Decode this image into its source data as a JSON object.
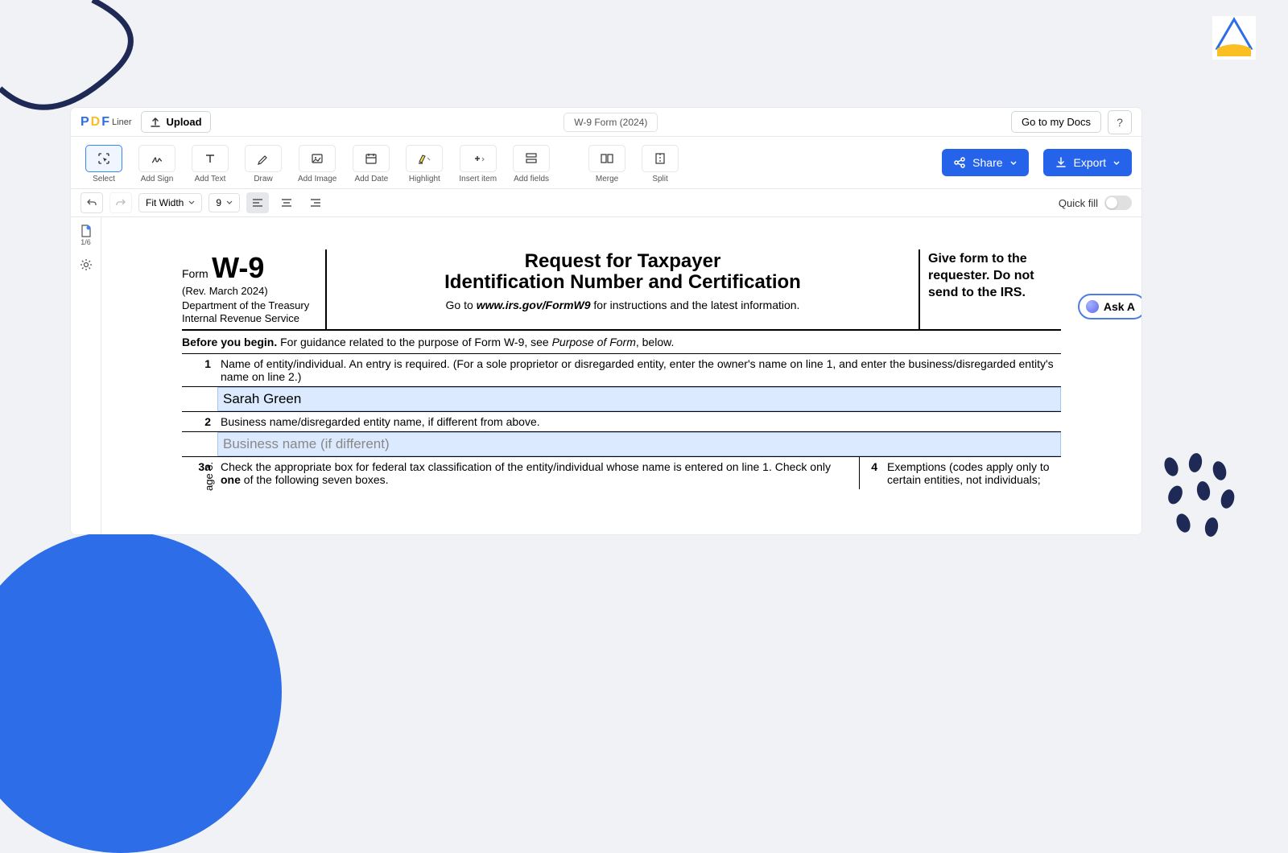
{
  "brand": {
    "p": "P",
    "d": "D",
    "f": "F",
    "liner": "Liner"
  },
  "topbar": {
    "upload_label": "Upload",
    "doc_title": "W-9 Form (2024)",
    "go_docs_label": "Go to my Docs",
    "help_label": "?"
  },
  "toolbar": {
    "select": "Select",
    "add_sign": "Add Sign",
    "add_text": "Add Text",
    "draw": "Draw",
    "add_image": "Add Image",
    "add_date": "Add Date",
    "highlight": "Highlight",
    "insert_item": "Insert item",
    "add_fields": "Add fields",
    "merge": "Merge",
    "split": "Split",
    "share": "Share",
    "export": "Export"
  },
  "subbar": {
    "zoom_mode": "Fit Width",
    "zoom_level": "9",
    "quickfill_label": "Quick fill"
  },
  "sidebar": {
    "page_indicator": "1/6"
  },
  "ask_ai_label": "Ask A",
  "form": {
    "form_label": "Form",
    "form_no": "W-9",
    "revision": "(Rev. March 2024)",
    "dept1": "Department of the Treasury",
    "dept2": "Internal Revenue Service",
    "title_l1": "Request for Taxpayer",
    "title_l2": "Identification Number and Certification",
    "url_prefix": "Go to ",
    "url": "www.irs.gov/FormW9",
    "url_suffix": " for instructions and the latest information.",
    "give_to": "Give form to the requester. Do not send to the IRS.",
    "before_label": "Before you begin.",
    "before_text": " For guidance related to the purpose of Form W-9, see ",
    "before_italic": "Purpose of Form",
    "before_tail": ", below.",
    "vertical_label": "age 3.",
    "line1_num": "1",
    "line1_text": "Name of entity/individual. An entry is required. (For a sole proprietor or disregarded entity, enter the owner's name on line 1, and enter the business/disregarded entity's name on line 2.)",
    "line1_value": "Sarah Green",
    "line2_num": "2",
    "line2_text": "Business name/disregarded entity name, if different from above.",
    "line2_placeholder": "Business name (if different)",
    "line3a_num": "3a",
    "line3a_pre": "Check the appropriate box for federal tax classification of the entity/individual whose name is entered on line 1. Check only ",
    "line3a_bold": "one",
    "line3a_post": " of the following seven boxes.",
    "line4_num": "4",
    "line4_text": "Exemptions (codes apply only to certain entities, not individuals;"
  }
}
